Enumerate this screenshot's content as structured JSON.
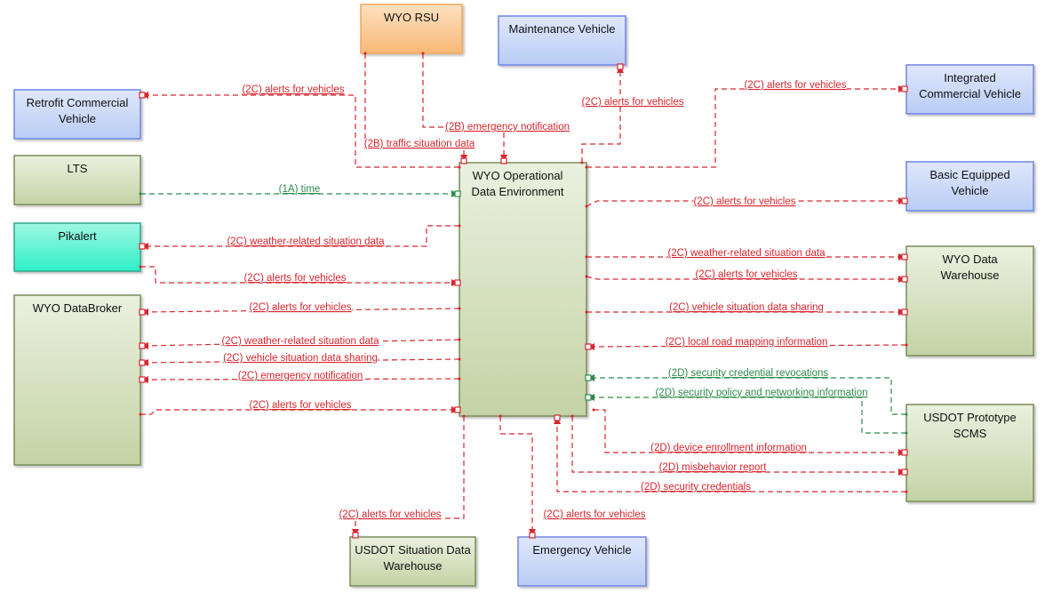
{
  "colors": {
    "flow_red": "#d7262e",
    "flow_green": "#2e8b4a",
    "blue_box": "#c3d3f7",
    "green_box": "#d3ddbf",
    "orange_box": "#f9c690",
    "teal_box": "#4ef0cc"
  },
  "boxes": [
    {
      "id": "rsu",
      "label": [
        "WYO RSU"
      ],
      "style": "orange"
    },
    {
      "id": "maint",
      "label": [
        "Maintenance Vehicle"
      ],
      "style": "blue"
    },
    {
      "id": "retrofit",
      "label": [
        "Retrofit Commercial",
        "Vehicle"
      ],
      "style": "blue"
    },
    {
      "id": "integrated",
      "label": [
        "Integrated",
        "Commercial Vehicle"
      ],
      "style": "blue"
    },
    {
      "id": "lts",
      "label": [
        "LTS"
      ],
      "style": "green"
    },
    {
      "id": "basic",
      "label": [
        "Basic Equipped",
        "Vehicle"
      ],
      "style": "blue"
    },
    {
      "id": "pikalert",
      "label": [
        "Pikalert"
      ],
      "style": "teal"
    },
    {
      "id": "warehouse",
      "label": [
        "WYO Data",
        "Warehouse"
      ],
      "style": "green"
    },
    {
      "id": "databroker",
      "label": [
        "WYO DataBroker"
      ],
      "style": "green"
    },
    {
      "id": "ode",
      "label": [
        "WYO Operational",
        "Data Environment"
      ],
      "style": "green"
    },
    {
      "id": "scms",
      "label": [
        "USDOT Prototype",
        "SCMS"
      ],
      "style": "green"
    },
    {
      "id": "sdw",
      "label": [
        "USDOT Situation Data",
        "Warehouse"
      ],
      "style": "green"
    },
    {
      "id": "emergency",
      "label": [
        "Emergency Vehicle"
      ],
      "style": "blue"
    }
  ],
  "flows": [
    {
      "label": "(2C) alerts for vehicles",
      "from": "WYO Operational Data Environment",
      "to": "Retrofit Commercial Vehicle",
      "color": "red"
    },
    {
      "label": "(2B) traffic situation data",
      "from": "WYO RSU",
      "to": "WYO Operational Data Environment",
      "color": "red"
    },
    {
      "label": "(2B) emergency notification",
      "from": "WYO RSU",
      "to": "WYO Operational Data Environment",
      "color": "red"
    },
    {
      "label": "(2C) alerts for vehicles",
      "from": "WYO Operational Data Environment",
      "to": "Maintenance Vehicle",
      "color": "red"
    },
    {
      "label": "(2C) alerts for vehicles",
      "from": "WYO Operational Data Environment",
      "to": "Integrated Commercial Vehicle",
      "color": "red"
    },
    {
      "label": "(1A) time",
      "from": "LTS",
      "to": "WYO Operational Data Environment",
      "color": "green"
    },
    {
      "label": "(2C) alerts for vehicles",
      "from": "WYO Operational Data Environment",
      "to": "Basic Equipped Vehicle",
      "color": "red"
    },
    {
      "label": "(2C) weather-related situation data",
      "from": "WYO Operational Data Environment",
      "to": "Pikalert",
      "color": "red"
    },
    {
      "label": "(2C) alerts for vehicles",
      "from": "Pikalert",
      "to": "WYO Operational Data Environment",
      "color": "red"
    },
    {
      "label": "(2C) weather-related situation data",
      "from": "WYO Operational Data Environment",
      "to": "WYO Data Warehouse",
      "color": "red"
    },
    {
      "label": "(2C) alerts for vehicles",
      "from": "WYO Operational Data Environment",
      "to": "WYO Data Warehouse",
      "color": "red"
    },
    {
      "label": "(2C) vehicle situation data sharing",
      "from": "WYO Operational Data Environment",
      "to": "WYO Data Warehouse",
      "color": "red"
    },
    {
      "label": "(2C) local road mapping information",
      "from": "WYO Data Warehouse",
      "to": "WYO Operational Data Environment",
      "color": "red"
    },
    {
      "label": "(2C) alerts for vehicles",
      "from": "WYO Operational Data Environment",
      "to": "WYO DataBroker",
      "color": "red"
    },
    {
      "label": "(2C) weather-related situation data",
      "from": "WYO Operational Data Environment",
      "to": "WYO DataBroker",
      "color": "red"
    },
    {
      "label": "(2C) vehicle situation data sharing",
      "from": "WYO Operational Data Environment",
      "to": "WYO DataBroker",
      "color": "red"
    },
    {
      "label": "(2C) emergency notification",
      "from": "WYO Operational Data Environment",
      "to": "WYO DataBroker",
      "color": "red"
    },
    {
      "label": "(2C) alerts for vehicles",
      "from": "WYO DataBroker",
      "to": "WYO Operational Data Environment",
      "color": "red"
    },
    {
      "label": "(2D) security credential revocations",
      "from": "USDOT Prototype SCMS",
      "to": "WYO Operational Data Environment",
      "color": "green"
    },
    {
      "label": "(2D) security policy and networking information",
      "from": "USDOT Prototype SCMS",
      "to": "WYO Operational Data Environment",
      "color": "green"
    },
    {
      "label": "(2D) device enrollment information",
      "from": "WYO Operational Data Environment",
      "to": "USDOT Prototype SCMS",
      "color": "red"
    },
    {
      "label": "(2D) misbehavior report",
      "from": "WYO Operational Data Environment",
      "to": "USDOT Prototype SCMS",
      "color": "red"
    },
    {
      "label": "(2D) security credentials",
      "from": "USDOT Prototype SCMS",
      "to": "WYO Operational Data Environment",
      "color": "red"
    },
    {
      "label": "(2C) alerts for vehicles",
      "from": "WYO Operational Data Environment",
      "to": "USDOT Situation Data Warehouse",
      "color": "red"
    },
    {
      "label": "(2C) alerts for vehicles",
      "from": "WYO Operational Data Environment",
      "to": "Emergency Vehicle",
      "color": "red"
    }
  ]
}
